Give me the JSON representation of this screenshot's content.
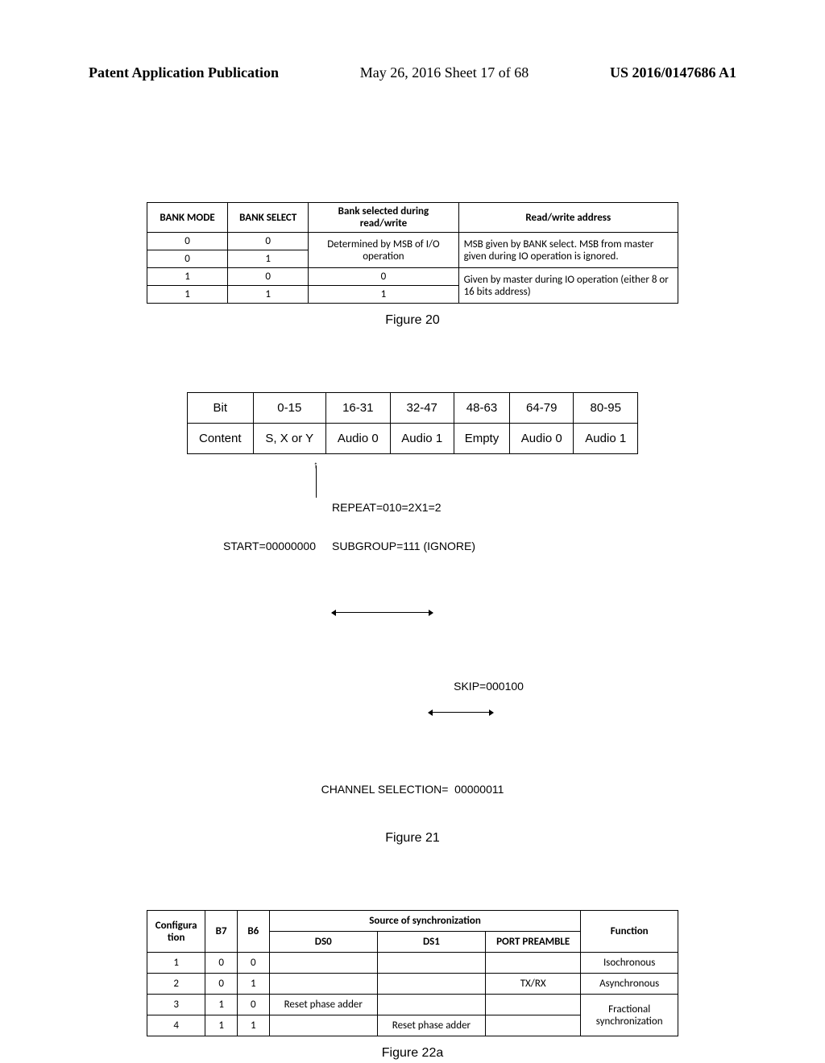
{
  "header": {
    "left": "Patent Application Publication",
    "center": "May 26, 2016  Sheet 17 of 68",
    "right": "US 2016/0147686 A1"
  },
  "fig20": {
    "caption": "Figure 20",
    "headers": {
      "bank_mode": "BANK MODE",
      "bank_select": "BANK SELECT",
      "selected": "Bank selected during read/write",
      "rw": "Read/write address"
    },
    "rows": {
      "r0_mode": "0",
      "r0_sel": "0",
      "r1_mode": "0",
      "r1_sel": "1",
      "r01_selected": "Determined by MSB of I/O operation",
      "r01_rw": "MSB given by BANK select. MSB from master given during IO operation is ignored.",
      "r2_mode": "1",
      "r2_sel": "0",
      "r2_selected": "0",
      "r3_mode": "1",
      "r3_sel": "1",
      "r3_selected": "1",
      "r23_rw": "Given by master during IO operation (either 8 or 16 bits address)"
    }
  },
  "fig21": {
    "caption": "Figure 21",
    "cols_label": "Bit",
    "row_label": "Content",
    "cols": [
      "0-15",
      "16-31",
      "32-47",
      "48-63",
      "64-79",
      "80-95"
    ],
    "row": [
      "S, X or Y",
      "Audio 0",
      "Audio 1",
      "Empty",
      "Audio 0",
      "Audio 1"
    ],
    "start": "START=00000000",
    "repeat": "REPEAT=010=2X1=2",
    "subgroup": "SUBGROUP=111 (IGNORE)",
    "skip": "SKIP=000100",
    "channel": "CHANNEL SELECTION=  00000011"
  },
  "fig22": {
    "caption": "Figure 22a",
    "headers": {
      "config": "Configura tion",
      "b7": "B7",
      "b6": "B6",
      "source": "Source of synchronization",
      "ds0": "DS0",
      "ds1": "DS1",
      "port": "PORT PREAMBLE",
      "func": "Function"
    },
    "rows": {
      "r1": {
        "cfg": "1",
        "b7": "0",
        "b6": "0",
        "ds0": "",
        "ds1": "",
        "port": "",
        "func": "Isochronous"
      },
      "r2": {
        "cfg": "2",
        "b7": "0",
        "b6": "1",
        "ds0": "",
        "ds1": "",
        "port": "TX/RX",
        "func": "Asynchronous"
      },
      "r3": {
        "cfg": "3",
        "b7": "1",
        "b6": "0",
        "ds0": "Reset phase adder",
        "ds1": "",
        "port": ""
      },
      "r4": {
        "cfg": "4",
        "b7": "1",
        "b6": "1",
        "ds0": "",
        "ds1": "Reset phase adder",
        "port": ""
      },
      "r34_func": "Fractional synchronization"
    }
  }
}
